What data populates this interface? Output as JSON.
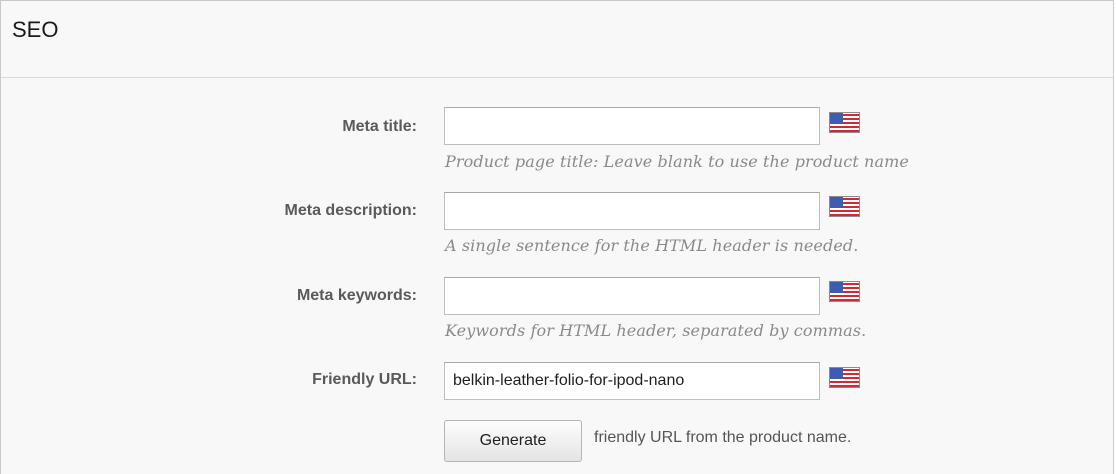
{
  "panel": {
    "title": "SEO"
  },
  "fields": {
    "meta_title": {
      "label": "Meta title:",
      "value": "",
      "help": "Product page title: Leave blank to use the product name",
      "flag_icon": "us-flag-icon"
    },
    "meta_description": {
      "label": "Meta description:",
      "value": "",
      "help": "A single sentence for the HTML header is needed.",
      "flag_icon": "us-flag-icon"
    },
    "meta_keywords": {
      "label": "Meta keywords:",
      "value": "",
      "help": "Keywords for HTML header, separated by commas.",
      "flag_icon": "us-flag-icon"
    },
    "friendly_url": {
      "label": "Friendly URL:",
      "value": "belkin-leather-folio-for-ipod-nano",
      "flag_icon": "us-flag-icon"
    }
  },
  "generate": {
    "button_label": "Generate",
    "note": "friendly URL from the product name."
  },
  "colors": {
    "label_text": "#585a5b",
    "help_text": "#8a8a8a",
    "panel_bg": "#f8f8f8",
    "flag_red": "#cc2a36",
    "flag_blue": "#3f5cb1"
  }
}
